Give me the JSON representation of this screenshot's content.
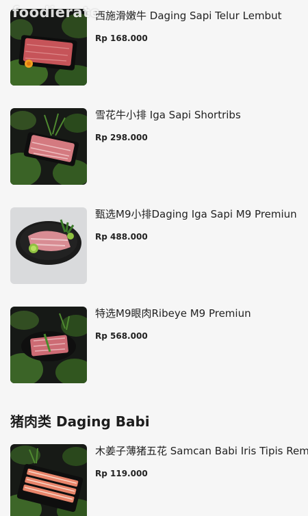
{
  "watermark": "foodierate",
  "items": [
    {
      "name": "西施滑嫩牛 Daging Sapi Telur Lembut",
      "price": "Rp 168.000",
      "image_icon": "beef-slices-on-slate-icon"
    },
    {
      "name": "雪花牛小排 Iga Sapi Shortribs",
      "price": "Rp 298.000",
      "image_icon": "marbled-shortrib-icon"
    },
    {
      "name": "甄选M9小排Daging Iga Sapi M9 Premiun",
      "price": "Rp 488.000",
      "image_icon": "premium-rib-plate-icon"
    },
    {
      "name": "特选M9眼肉Ribeye M9 Premiun",
      "price": "Rp 568.000",
      "image_icon": "ribeye-plate-icon"
    }
  ],
  "section": {
    "title": "猪肉类 Daging Babi"
  },
  "pork_items": [
    {
      "name": "木姜子薄猪五花 Samcan Babi Iris Tipis Rempah",
      "price": "Rp 119.000",
      "image_icon": "pork-belly-slices-icon"
    }
  ],
  "colors": {
    "background": "#f6f6f6",
    "text": "#1d1d1d",
    "moss": "#3d6b2a",
    "dark": "#151515",
    "meat": "#c8505a"
  }
}
